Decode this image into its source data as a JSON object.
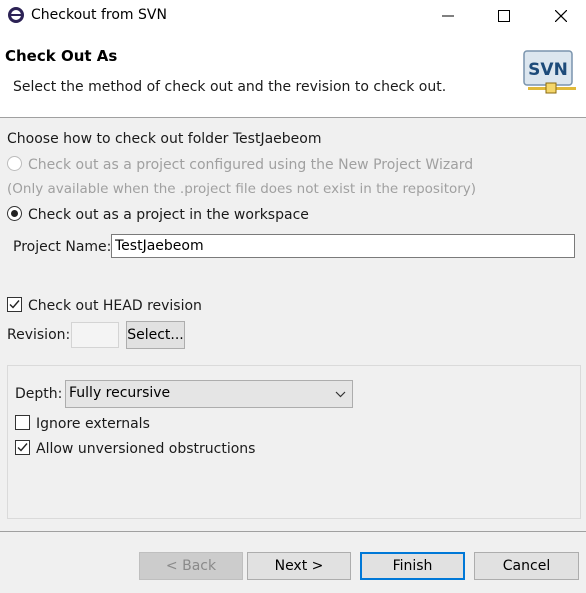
{
  "window": {
    "title": "Checkout from SVN"
  },
  "banner": {
    "title": "Check Out As",
    "description": "Select the method of check out and the revision to check out.",
    "logo_text": "SVN"
  },
  "form": {
    "choose_label": "Choose how to check out folder TestJaebeom",
    "option_wizard": "Check out as a project configured using the New Project Wizard",
    "option_wizard_note": "(Only available when the .project file does not exist in the repository)",
    "option_workspace": "Check out as a project in the workspace",
    "project_name_label": "Project Name:",
    "project_name_value": "TestJaebeom",
    "head_revision_label": "Check out HEAD revision",
    "revision_label": "Revision:",
    "select_button": "Select...",
    "depth_label": "Depth:",
    "depth_value": "Fully recursive",
    "ignore_externals_label": "Ignore externals",
    "allow_unversioned_label": "Allow unversioned obstructions"
  },
  "buttons": {
    "back": "< Back",
    "next": "Next >",
    "finish": "Finish",
    "cancel": "Cancel"
  },
  "state": {
    "selected_option": "workspace",
    "head_revision_checked": true,
    "ignore_externals_checked": false,
    "allow_unversioned_checked": true
  },
  "colors": {
    "accent": "#0078d7",
    "disabled_text": "#a0a0a0"
  }
}
